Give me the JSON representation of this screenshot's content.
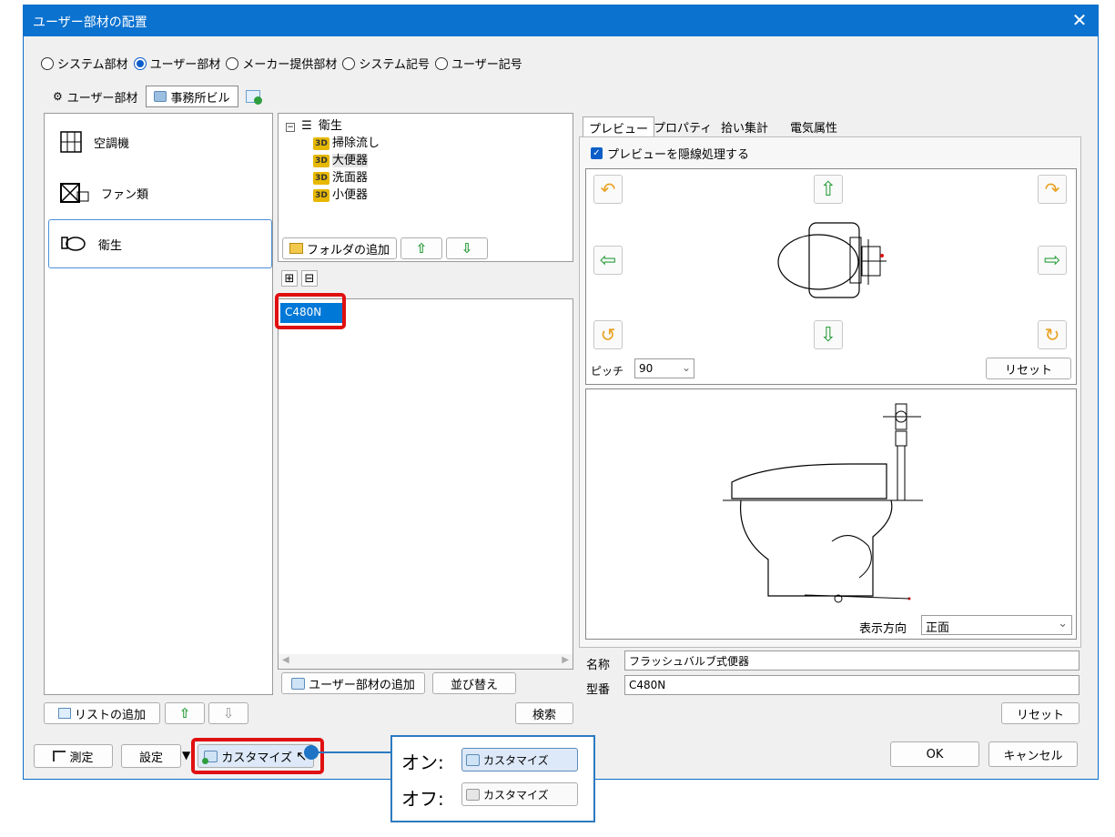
{
  "window": {
    "title": "ユーザー部材の配置",
    "close_glyph": "✕"
  },
  "source_radios": [
    {
      "label": "システム部材",
      "selected": false
    },
    {
      "label": "ユーザー部材",
      "selected": true
    },
    {
      "label": "メーカー提供部材",
      "selected": false
    },
    {
      "label": "システム記号",
      "selected": false
    },
    {
      "label": "ユーザー記号",
      "selected": false
    }
  ],
  "tabs": [
    {
      "label": "ユーザー部材",
      "active": false
    },
    {
      "label": "事務所ビル",
      "active": true
    }
  ],
  "categories": [
    {
      "label": "空調機",
      "icon": "aircon-icon"
    },
    {
      "label": "ファン類",
      "icon": "fan-icon"
    },
    {
      "label": "衛生",
      "icon": "sanitary-icon",
      "selected": true
    }
  ],
  "left_buttons": {
    "add_list": "リストの追加"
  },
  "tree": {
    "root": "衛生",
    "children": [
      "掃除流し",
      "大便器",
      "洗面器",
      "小便器"
    ],
    "selected": "大便器",
    "badge": "3D"
  },
  "folder_buttons": {
    "add_folder": "フォルダの追加"
  },
  "expand_buttons": {
    "expand": "⊞",
    "collapse": "⊟"
  },
  "parts_list": {
    "items": [
      "C480N"
    ],
    "selected": "C480N"
  },
  "parts_buttons": {
    "add_part": "ユーザー部材の追加",
    "sort": "並び替え",
    "search": "検索"
  },
  "right_tabs": [
    "プレビュー",
    "プロパティ",
    "拾い集計",
    "電気属性"
  ],
  "preview": {
    "hidden_line_label": "プレビューを隠線処理する",
    "hidden_line_checked": true,
    "pitch_label": "ピッチ",
    "pitch_value": "90",
    "reset_label": "リセット",
    "direction_label": "表示方向",
    "direction_value": "正面"
  },
  "properties": {
    "name_label": "名称",
    "name_value": "フラッシュバルブ式便器",
    "model_label": "型番",
    "model_value": "C480N",
    "reset_label": "リセット"
  },
  "bottom": {
    "measure": "測定",
    "settings": "設定",
    "customize": "カスタマイズ",
    "ok": "OK",
    "cancel": "キャンセル"
  },
  "callout": {
    "on_label": "オン:",
    "off_label": "オフ:",
    "button_label": "カスタマイズ"
  },
  "colors": {
    "titlebar": "#0b72d0",
    "selection": "#0078d7",
    "highlight_box": "#e01010",
    "callout_border": "#2b7ac0",
    "arrow_green": "#2e9e3e",
    "arrow_orange": "#e8a020"
  }
}
